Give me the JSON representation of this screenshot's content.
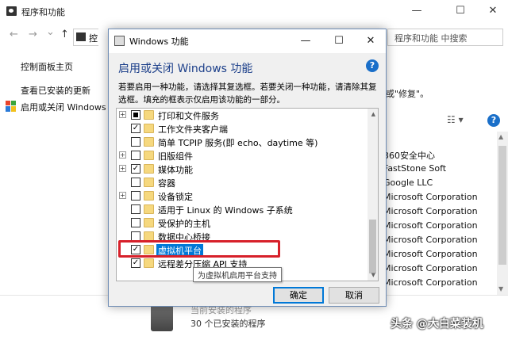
{
  "background": {
    "window_title": "程序和功能",
    "min_glyph": "—",
    "max_glyph": "☐",
    "close_glyph": "✕",
    "back_glyph": "←",
    "forward_glyph": "→",
    "dropdown_glyph": "⌄",
    "up_glyph": "↑",
    "address_text": "控",
    "search_placeholder": "程序和功能 中搜索",
    "left_links": [
      "控制面板主页",
      "查看已安装的更新",
      "启用或关闭 Windows 功"
    ],
    "right_text_1": "或\"修复\"。",
    "view_glyph": "☷ ▾",
    "help_glyph": "?",
    "publishers": [
      "\"",
      "360安全中心",
      "FastStone Soft",
      "Google LLC",
      "Microsoft Corporation",
      "Microsoft Corporation",
      "Microsoft Corporation",
      "Microsoft Corporation",
      "Microsoft Corporation",
      "Microsoft Corporation",
      "Microsoft Corporation"
    ],
    "bottom_line1": "当前安装的程序",
    "bottom_line2": "30 个已安装的程序",
    "watermark": "头条 @大白菜装机"
  },
  "dialog": {
    "title": "Windows 功能",
    "minimize_glyph": "—",
    "maximize_glyph": "☐",
    "close_glyph": "✕",
    "heading": "启用或关闭 Windows 功能",
    "help_glyph": "?",
    "description": "若要启用一种功能，请选择其复选框。若要关闭一种功能，请清除其复选框。填充的框表示仅启用该功能的一部分。",
    "features": [
      {
        "label": "打印和文件服务",
        "expandable": true,
        "state": "partial"
      },
      {
        "label": "工作文件夹客户端",
        "expandable": false,
        "state": "checked"
      },
      {
        "label": "简单 TCPIP 服务(即 echo、daytime 等)",
        "expandable": false,
        "state": "unchecked"
      },
      {
        "label": "旧版组件",
        "expandable": true,
        "state": "unchecked"
      },
      {
        "label": "媒体功能",
        "expandable": true,
        "state": "checked"
      },
      {
        "label": "容器",
        "expandable": false,
        "state": "unchecked"
      },
      {
        "label": "设备锁定",
        "expandable": true,
        "state": "unchecked"
      },
      {
        "label": "适用于 Linux 的 Windows 子系统",
        "expandable": false,
        "state": "unchecked"
      },
      {
        "label": "受保护的主机",
        "expandable": false,
        "state": "unchecked"
      },
      {
        "label": "数据中心桥接",
        "expandable": false,
        "state": "unchecked"
      },
      {
        "label": "虚拟机平台",
        "expandable": false,
        "state": "checked",
        "selected": true
      },
      {
        "label": "远程差分压缩 API 支持",
        "expandable": false,
        "state": "checked"
      }
    ],
    "tooltip": "为虚拟机启用平台支持",
    "ok_label": "确定",
    "cancel_label": "取消",
    "expander_glyph": "+",
    "check_glyph": "✓",
    "scroll_up_glyph": "▲",
    "scroll_down_glyph": "▼"
  }
}
